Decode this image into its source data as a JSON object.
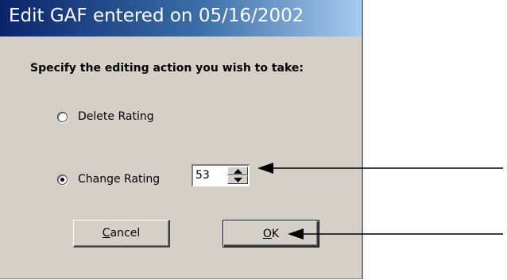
{
  "dialog": {
    "title": "Edit GAF entered on 05/16/2002",
    "prompt": "Specify the editing action you wish to take:"
  },
  "options": [
    {
      "label": "Delete Rating",
      "checked": false
    },
    {
      "label": "Change Rating",
      "checked": true
    }
  ],
  "rating_spinner": {
    "value": "53"
  },
  "buttons": {
    "cancel": {
      "mnemonic": "C",
      "rest": "ancel"
    },
    "ok": {
      "mnemonic": "O",
      "rest": "K"
    }
  },
  "colors": {
    "dialog_face": "#d4d0c8",
    "titlebar_start": "#0a246a",
    "titlebar_end": "#a6caf0",
    "title_text": "#ffffff"
  },
  "icons": {
    "spin_up": "triangle-up",
    "spin_down": "triangle-down",
    "annotation": "arrow-left"
  }
}
